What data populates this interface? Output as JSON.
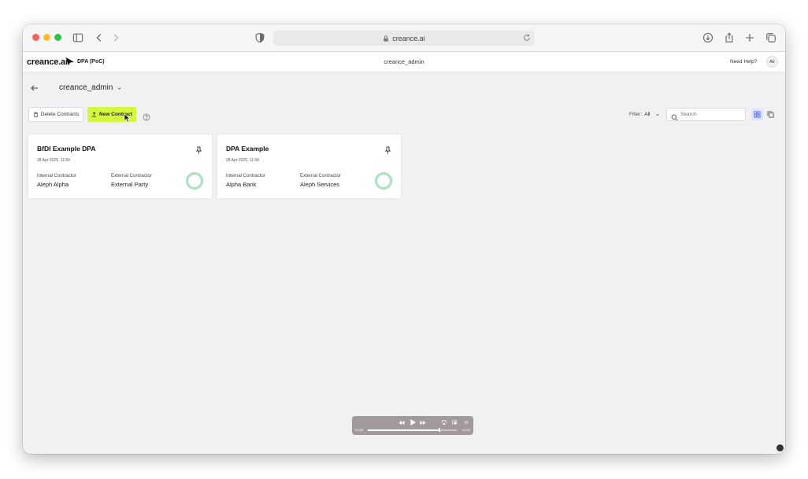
{
  "browser": {
    "url": "creance.ai"
  },
  "header": {
    "logo_text": "creance.ai",
    "product_label": "DPA (PoC)",
    "current_user": "creance_admin",
    "help_label": "Need Help?",
    "avatar_initials": "AE"
  },
  "toolbar": {
    "org_name": "creance_admin",
    "delete_label": "Delete Contracts",
    "new_label": "New Contract",
    "filter_label": "Filter:",
    "filter_value": "All",
    "search_placeholder": "Search"
  },
  "contracts": [
    {
      "title": "BfDI Example DPA",
      "date": "28 Apr 2025, 11:59",
      "internal_label": "Internal Contractor",
      "internal_value": "Aleph Alpha",
      "external_label": "External Contractor",
      "external_value": "External Party",
      "score_fraction": 0.97
    },
    {
      "title": "DPA Example",
      "date": "28 Apr 2025, 11:58",
      "internal_label": "Internal Contractor",
      "internal_value": "Alpha Bank",
      "external_label": "External Contractor",
      "external_value": "Aleph Services",
      "score_fraction": 1.0
    }
  ],
  "media": {
    "elapsed": "01:50",
    "remaining": "01:53",
    "progress_fraction": 0.8
  },
  "colors": {
    "accent": "#d4f83b",
    "donut_ok": "#a8e3c4",
    "donut_flag": "#f3b3b3",
    "grid_active": "#dde4ff"
  }
}
